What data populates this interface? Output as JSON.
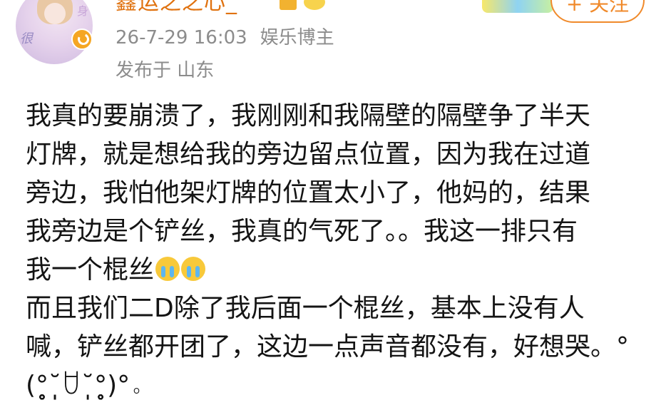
{
  "user": {
    "name": "鑫运之之心_",
    "avatar_text_left": "很",
    "avatar_text_right": "身"
  },
  "post_meta": {
    "date": "26-7-29 16:03",
    "label": "娱乐博主",
    "location": "发布于 山东"
  },
  "follow_button": {
    "label": "+ 关注"
  },
  "post": {
    "lines": [
      "我真的要崩溃了，我刚刚和我隔壁的隔壁争了半天",
      "灯牌，就是想给我的旁边留点位置，因为我在过道",
      "旁边，我怕他架灯牌的位置太小了，他妈的，结果",
      "我旁边是个铲丝，我真的气死了。。我这一排只有",
      "我一个棍丝",
      "而且我们二D除了我后面一个棍丝，基本上没有人",
      "喊，铲丝都开团了，这边一点声音都没有，好想哭。°",
      "(°̥̥̥̥̥̥̥̥˘̩̩̩̩̩̩ꇴ˘̩̩̩̩̩̩°̥̥̥̥̥̥̥̥)°。"
    ],
    "emoji_names": [
      "loudly-crying-face",
      "loudly-crying-face"
    ]
  },
  "colors": {
    "username": "#e0720f",
    "meta_text": "#8c8c8c",
    "follow_accent": "#f08a2b",
    "body_text": "#141414"
  }
}
